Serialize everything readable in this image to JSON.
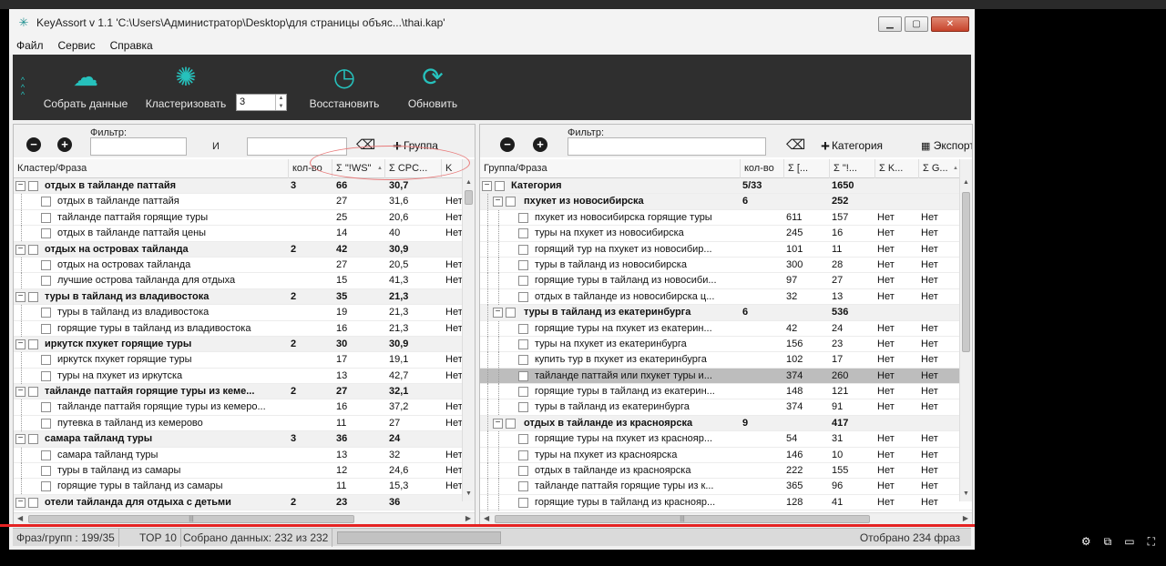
{
  "window": {
    "title": "KeyAssort v 1.1  'C:\\Users\\Администратор\\Desktop\\для страницы объяс...\\thai.kap'"
  },
  "menu": [
    "Файл",
    "Сервис",
    "Справка"
  ],
  "toolbar": {
    "collect": "Собрать данные",
    "cluster": "Кластеризовать",
    "spin_value": "3",
    "restore": "Восстановить",
    "refresh": "Обновить"
  },
  "left": {
    "filter_label": "Фильтр:",
    "and_label": "И",
    "add_group": "Группа",
    "headers": [
      "Кластер/Фраза",
      "кол-во",
      "Σ \"!WS\"",
      "Σ CPC...",
      "K"
    ],
    "rows": [
      {
        "t": "g",
        "name": "отдых в тайланде паттайя",
        "count": "3",
        "ws": "66",
        "cpc": "30,7",
        "k": ""
      },
      {
        "t": "c",
        "name": "отдых в тайланде паттайя",
        "ws": "27",
        "cpc": "31,6",
        "k": "Нет"
      },
      {
        "t": "c",
        "name": "тайланде паттайя горящие туры",
        "ws": "25",
        "cpc": "20,6",
        "k": "Нет"
      },
      {
        "t": "c",
        "name": "отдых в тайланде паттайя цены",
        "ws": "14",
        "cpc": "40",
        "k": "Нет"
      },
      {
        "t": "g",
        "name": "отдых на островах тайланда",
        "count": "2",
        "ws": "42",
        "cpc": "30,9",
        "k": ""
      },
      {
        "t": "c",
        "name": "отдых на островах тайланда",
        "ws": "27",
        "cpc": "20,5",
        "k": "Нет"
      },
      {
        "t": "c",
        "name": "лучшие острова тайланда для отдыха",
        "ws": "15",
        "cpc": "41,3",
        "k": "Нет"
      },
      {
        "t": "g",
        "name": "туры в тайланд из владивостока",
        "count": "2",
        "ws": "35",
        "cpc": "21,3",
        "k": ""
      },
      {
        "t": "c",
        "name": "туры в тайланд из владивостока",
        "ws": "19",
        "cpc": "21,3",
        "k": "Нет"
      },
      {
        "t": "c",
        "name": "горящие туры в тайланд из владивостока",
        "ws": "16",
        "cpc": "21,3",
        "k": "Нет"
      },
      {
        "t": "g",
        "name": "иркутск пхукет горящие туры",
        "count": "2",
        "ws": "30",
        "cpc": "30,9",
        "k": ""
      },
      {
        "t": "c",
        "name": "иркутск пхукет горящие туры",
        "ws": "17",
        "cpc": "19,1",
        "k": "Нет"
      },
      {
        "t": "c",
        "name": "туры на пхукет из иркутска",
        "ws": "13",
        "cpc": "42,7",
        "k": "Нет"
      },
      {
        "t": "g",
        "name": "тайланде паттайя горящие туры из кеме...",
        "count": "2",
        "ws": "27",
        "cpc": "32,1",
        "k": ""
      },
      {
        "t": "c",
        "name": "тайланде паттайя горящие туры из кемеро...",
        "ws": "16",
        "cpc": "37,2",
        "k": "Нет"
      },
      {
        "t": "c",
        "name": "путевка в тайланд из кемерово",
        "ws": "11",
        "cpc": "27",
        "k": "Нет"
      },
      {
        "t": "g",
        "name": "самара тайланд туры",
        "count": "3",
        "ws": "36",
        "cpc": "24",
        "k": ""
      },
      {
        "t": "c",
        "name": "самара тайланд туры",
        "ws": "13",
        "cpc": "32",
        "k": "Нет"
      },
      {
        "t": "c",
        "name": "туры в тайланд из самары",
        "ws": "12",
        "cpc": "24,6",
        "k": "Нет"
      },
      {
        "t": "c",
        "name": "горящие туры в тайланд из самары",
        "ws": "11",
        "cpc": "15,3",
        "k": "Нет"
      },
      {
        "t": "g",
        "name": "отели тайланда для отдыха с детьми",
        "count": "2",
        "ws": "23",
        "cpc": "36",
        "k": ""
      }
    ]
  },
  "right": {
    "filter_label": "Фильтр:",
    "add_category": "Категория",
    "export": "Экспорт",
    "headers": [
      "Группа/Фраза",
      "кол-во",
      "Σ [...",
      "Σ \"!...",
      "Σ K...",
      "Σ G..."
    ],
    "rows": [
      {
        "t": "r",
        "name": "Категория",
        "count": "5/33",
        "a": "",
        "b": "1650",
        "c": "",
        "d": ""
      },
      {
        "t": "g",
        "name": "пхукет из новосибирска",
        "count": "6",
        "a": "",
        "b": "252",
        "c": "",
        "d": ""
      },
      {
        "t": "c",
        "name": "пхукет из новосибирска горящие туры",
        "a": "611",
        "b": "157",
        "c": "Нет",
        "d": "Нет"
      },
      {
        "t": "c",
        "name": "туры на пхукет из новосибирска",
        "a": "245",
        "b": "16",
        "c": "Нет",
        "d": "Нет"
      },
      {
        "t": "c",
        "name": "горящий тур на пхукет из новосибир...",
        "a": "101",
        "b": "11",
        "c": "Нет",
        "d": "Нет"
      },
      {
        "t": "c",
        "name": "туры в тайланд из новосибирска",
        "a": "300",
        "b": "28",
        "c": "Нет",
        "d": "Нет"
      },
      {
        "t": "c",
        "name": "горящие туры в тайланд из новосиби...",
        "a": "97",
        "b": "27",
        "c": "Нет",
        "d": "Нет"
      },
      {
        "t": "c",
        "name": "отдых в тайланде из новосибирска ц...",
        "a": "32",
        "b": "13",
        "c": "Нет",
        "d": "Нет"
      },
      {
        "t": "g",
        "name": "туры в тайланд из екатеринбурга",
        "count": "6",
        "a": "",
        "b": "536",
        "c": "",
        "d": ""
      },
      {
        "t": "c",
        "name": "горящие туры на пхукет из екатерин...",
        "a": "42",
        "b": "24",
        "c": "Нет",
        "d": "Нет"
      },
      {
        "t": "c",
        "name": "туры на пхукет из екатеринбурга",
        "a": "156",
        "b": "23",
        "c": "Нет",
        "d": "Нет"
      },
      {
        "t": "c",
        "name": "купить тур в пхукет из екатеринбурга",
        "a": "102",
        "b": "17",
        "c": "Нет",
        "d": "Нет"
      },
      {
        "t": "s",
        "name": "тайланде паттайя или пхукет туры и...",
        "a": "374",
        "b": "260",
        "c": "Нет",
        "d": "Нет"
      },
      {
        "t": "c",
        "name": "горящие туры в тайланд из екатерин...",
        "a": "148",
        "b": "121",
        "c": "Нет",
        "d": "Нет"
      },
      {
        "t": "c",
        "name": "туры в тайланд из екатеринбурга",
        "a": "374",
        "b": "91",
        "c": "Нет",
        "d": "Нет"
      },
      {
        "t": "g",
        "name": "отдых в тайланде из красноярска",
        "count": "9",
        "a": "",
        "b": "417",
        "c": "",
        "d": ""
      },
      {
        "t": "c",
        "name": "горящие туры на пхукет из краснояр...",
        "a": "54",
        "b": "31",
        "c": "Нет",
        "d": "Нет"
      },
      {
        "t": "c",
        "name": "туры на пхукет из красноярска",
        "a": "146",
        "b": "10",
        "c": "Нет",
        "d": "Нет"
      },
      {
        "t": "c",
        "name": "отдых в тайланде из красноярска",
        "a": "222",
        "b": "155",
        "c": "Нет",
        "d": "Нет"
      },
      {
        "t": "c",
        "name": "тайланде паттайя горящие туры из к...",
        "a": "365",
        "b": "96",
        "c": "Нет",
        "d": "Нет"
      },
      {
        "t": "c",
        "name": "горящие туры в тайланд из краснояр...",
        "a": "128",
        "b": "41",
        "c": "Нет",
        "d": "Нет"
      }
    ]
  },
  "status": {
    "phrases": "Фраз/групп :   199/35",
    "top": "TOP 10",
    "collected": "Собрано данных:  232 из 232",
    "shown": "Отобрано 234 фраз"
  },
  "colors": {
    "accent": "#26c1bc",
    "toolbar_bg": "#2f2f2f",
    "annotation": "#e87a7a",
    "progress": "#e52222"
  }
}
